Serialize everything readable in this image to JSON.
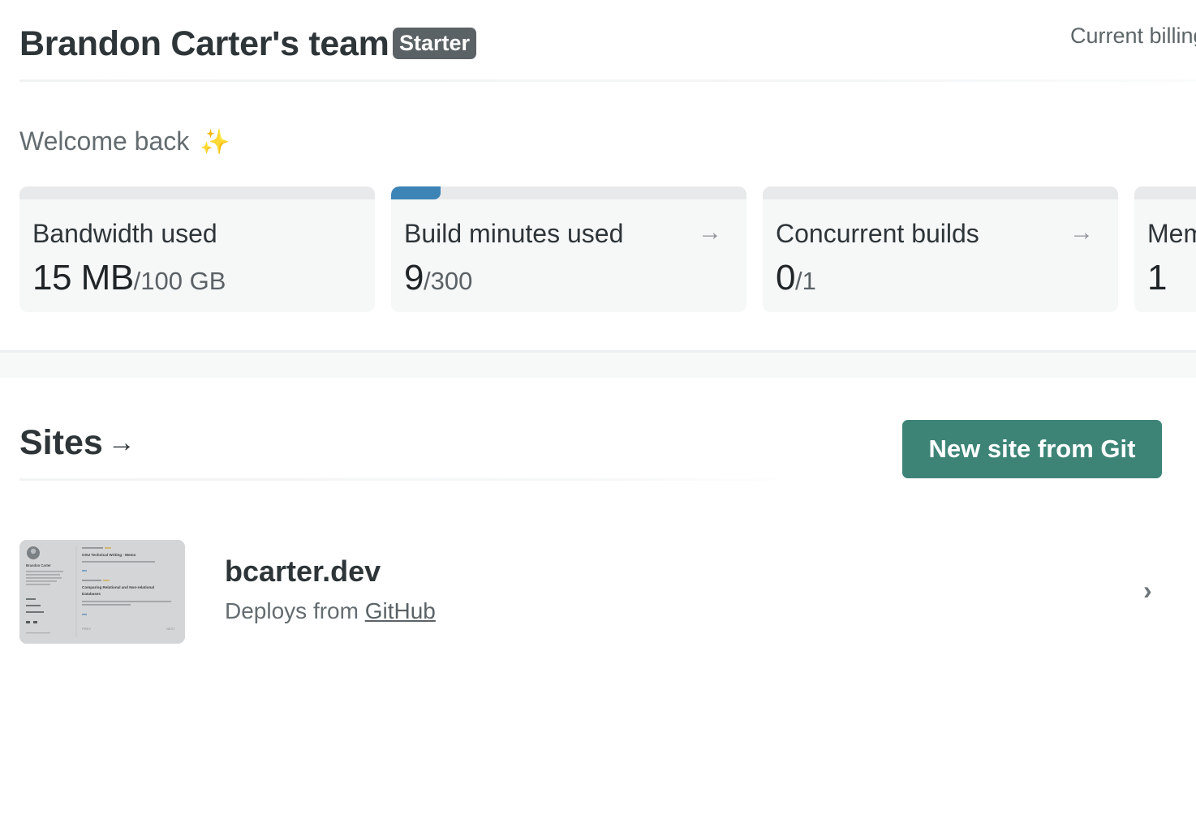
{
  "header": {
    "team_name": "Brandon Carter's team",
    "plan_badge": "Starter",
    "billing_link": "Current billing"
  },
  "welcome": {
    "text": "Welcome back",
    "emoji": "✨"
  },
  "usage_cards": [
    {
      "label": "Bandwidth used",
      "value": "15 MB",
      "limit": "/100 GB",
      "progress": 0.0
    },
    {
      "label": "Build minutes used",
      "value": "9",
      "limit": "/300",
      "progress": 0.03,
      "arrow": "→"
    },
    {
      "label": "Concurrent builds",
      "value": "0",
      "limit": "/1",
      "progress": 0.0,
      "arrow": "→"
    },
    {
      "label": "Members",
      "value": "1",
      "limit": "",
      "progress": 0.0
    }
  ],
  "sites": {
    "title": "Sites",
    "title_arrow": "→",
    "new_site_button": "New site from Git",
    "items": [
      {
        "name": "bcarter.dev",
        "deploy_prefix": "Deploys from ",
        "deploy_source": "GitHub",
        "thumbnail": {
          "author": "Brandon Carter",
          "post1_title": "OSU Technical Writing - Memo",
          "post2_title": "Comparing Relational and Non-relational Databases",
          "prev": "PREV",
          "next": "NEXT"
        }
      }
    ]
  },
  "colors": {
    "text": "#2e3538",
    "badge_bg": "#5b6266",
    "button_bg": "#3d8477",
    "progress_fill": "#3d84b6",
    "card_bg": "#f6f7f7"
  },
  "icons": [
    "arrow-right-icon",
    "chevron-right-icon",
    "sparkles-icon"
  ]
}
